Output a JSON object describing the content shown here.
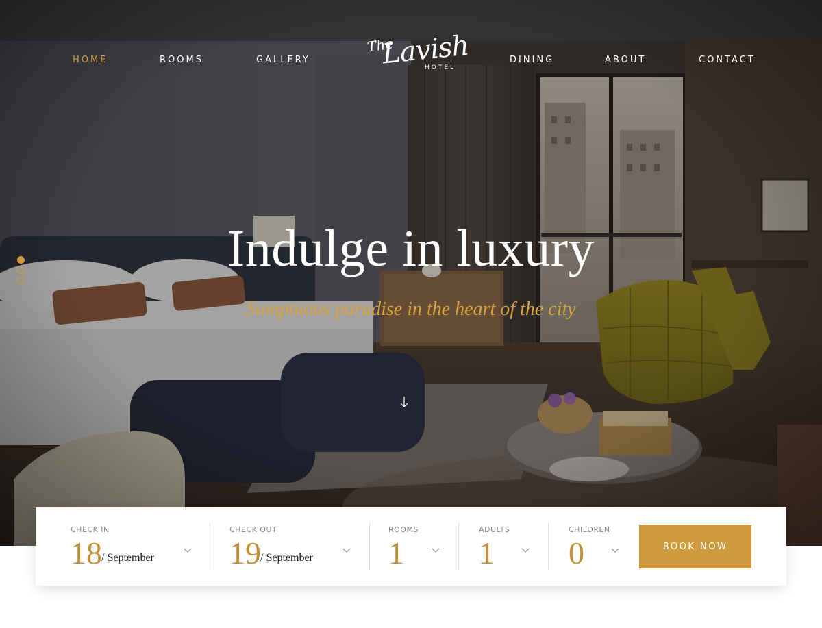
{
  "nav": {
    "items": [
      {
        "label": "HOME",
        "active": true
      },
      {
        "label": "ROOMS",
        "active": false
      },
      {
        "label": "GALLERY",
        "active": false
      },
      {
        "label": "DINING",
        "active": false
      },
      {
        "label": "ABOUT",
        "active": false
      },
      {
        "label": "CONTACT",
        "active": false
      }
    ]
  },
  "logo": {
    "the": "The",
    "name": "Lavish",
    "sub": "HOTEL"
  },
  "hero": {
    "title": "Indulge in luxury",
    "subtitle": "Sumptuous paradise in the heart of the city",
    "scroll_icon": "arrow-down-icon",
    "slides": 3,
    "active_slide": 1
  },
  "booking": {
    "check_in": {
      "label": "CHECK IN",
      "day": "18",
      "month": "/ September"
    },
    "check_out": {
      "label": "CHECK OUT",
      "day": "19",
      "month": "/ September"
    },
    "rooms": {
      "label": "ROOMS",
      "value": "1"
    },
    "adults": {
      "label": "ADULTS",
      "value": "1"
    },
    "children": {
      "label": "CHILDREN",
      "value": "0"
    },
    "button": "BOOK NOW"
  },
  "colors": {
    "accent": "#cf9a3d",
    "text_dark": "#222222",
    "label": "#8a8a8a"
  }
}
